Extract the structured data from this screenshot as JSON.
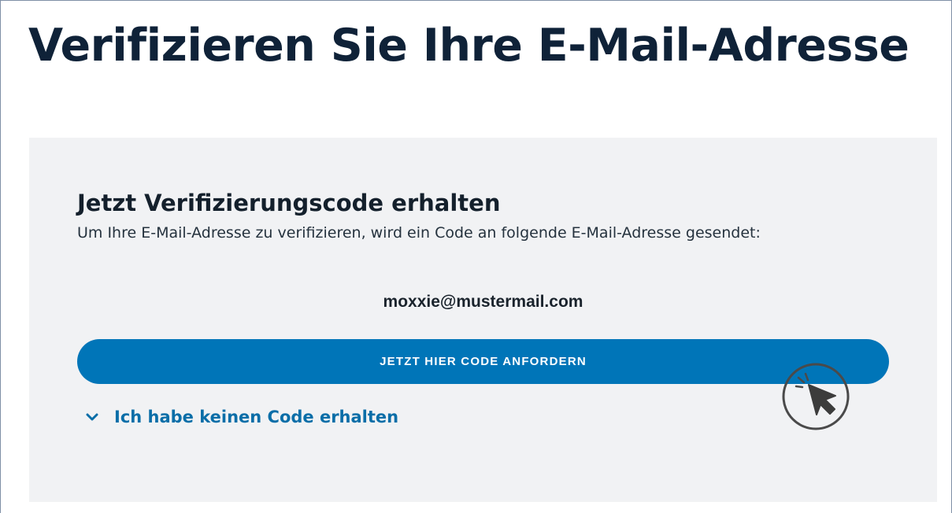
{
  "page": {
    "title": "Verifizieren Sie Ihre E-Mail-Adresse"
  },
  "card": {
    "heading": "Jetzt Verifizierungscode erhalten",
    "description": "Um Ihre E-Mail-Adresse zu verifizieren, wird ein Code an folgende E-Mail-Adresse gesendet:",
    "email": "moxxie@mustermail.com",
    "request_button_label": "JETZT HIER CODE ANFORDERN",
    "no_code_toggle_label": "Ich habe keinen Code erhalten",
    "no_code_toggle_icon": "chevron-down-icon"
  },
  "overlay": {
    "cursor_icon": "click-cursor-icon"
  },
  "colors": {
    "title_text": "#0f2238",
    "card_background": "#f1f2f4",
    "primary_button": "#0075b8",
    "link_text": "#0a6ea8"
  }
}
